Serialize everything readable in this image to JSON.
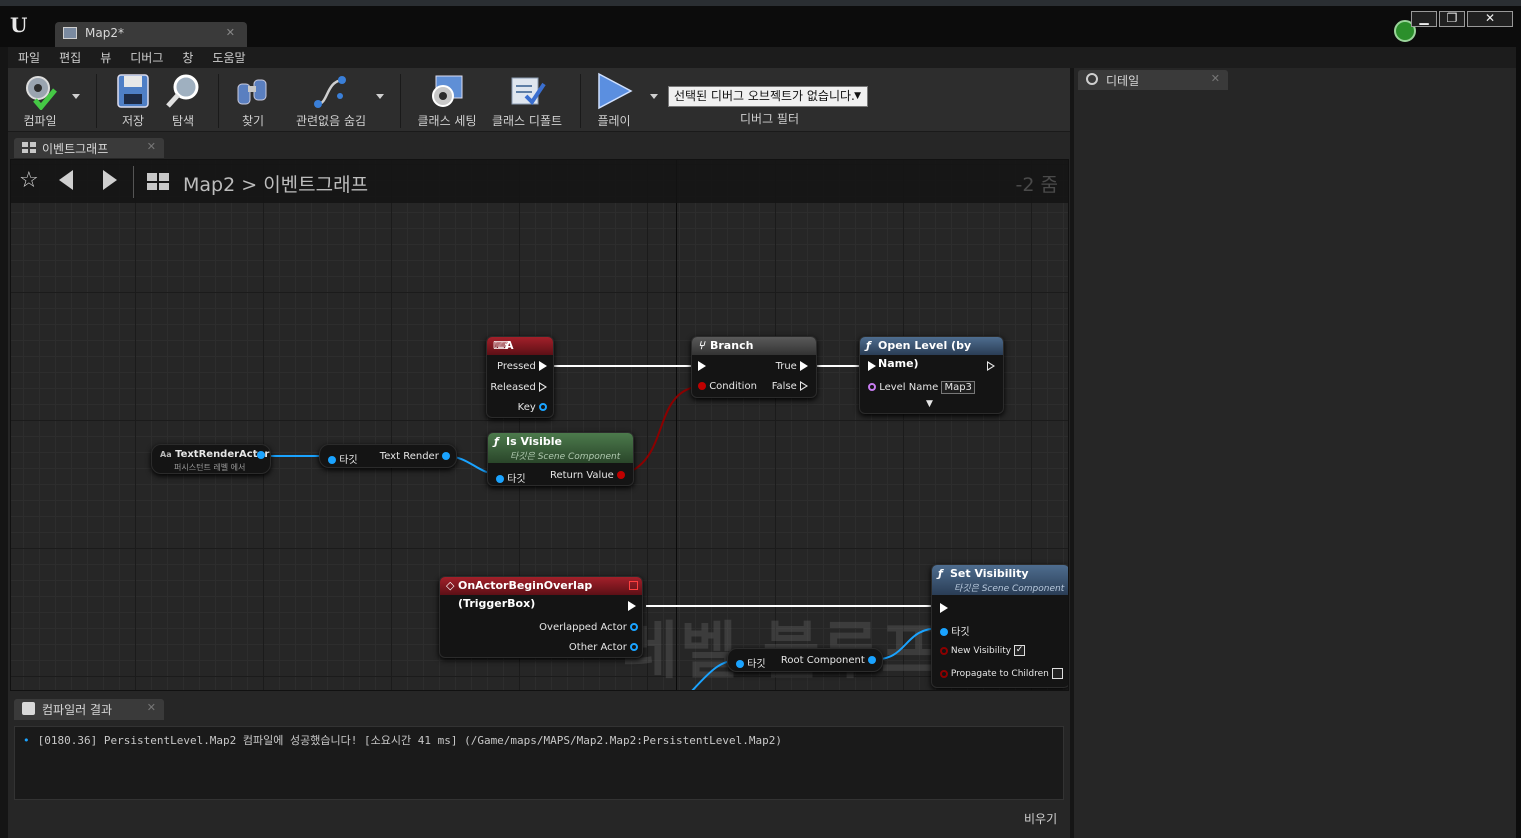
{
  "window": {
    "doc_tab_label": "Map2*",
    "min": "▁",
    "max": "❐",
    "close": "✕"
  },
  "menu": [
    "파일",
    "편집",
    "뷰",
    "디버그",
    "창",
    "도움말"
  ],
  "toolbar": {
    "compile": "컴파일",
    "save": "저장",
    "browse": "탐색",
    "find": "찾기",
    "hide_unrelated": "관련없음 숨김",
    "class_settings": "클래스 세팅",
    "class_defaults": "클래스 디폴트",
    "play": "플레이",
    "debug_object": "선택된 디버그 오브젝트가 없습니다.",
    "debug_filter": "디버그 필터"
  },
  "graph_tab": {
    "label": "이벤트그래프"
  },
  "breadcrumb": {
    "root": "Map2",
    "sep": ">",
    "current": "이벤트그래프",
    "zoom": "-2 줌"
  },
  "watermark": "레벨 블루프린트",
  "nodes": {
    "key_a": {
      "title": "A",
      "pressed": "Pressed",
      "released": "Released",
      "key": "Key"
    },
    "branch": {
      "title": "Branch",
      "true": "True",
      "false": "False",
      "condition": "Condition"
    },
    "open_level": {
      "title": "Open Level (by Name)",
      "level_name": "Level Name",
      "level_value": "Map3"
    },
    "text_render_actor": {
      "title": "TextRenderActor",
      "sub": "퍼시스턴트 레벨 에서"
    },
    "text_render_get": {
      "target": "타깃",
      "out": "Text Render"
    },
    "is_visible": {
      "title": "Is Visible",
      "sub": "타깃은 Scene Component",
      "target": "타깃",
      "ret": "Return Value"
    },
    "overlap": {
      "title": "OnActorBeginOverlap (TriggerBox)",
      "overlapped": "Overlapped Actor",
      "other": "Other Actor"
    },
    "root_comp": {
      "target": "타깃",
      "out": "Root Component"
    },
    "set_visibility": {
      "title": "Set Visibility",
      "sub": "타깃은 Scene Component",
      "target": "타깃",
      "new_vis": "New Visibility",
      "propagate": "Propagate to Children",
      "check": "✓"
    }
  },
  "compiler": {
    "tab": "컴파일러 결과",
    "log": "[0180.36] PersistentLevel.Map2 컴파일에 성공했습니다! [소요시간 41 ms] (/Game/maps/MAPS/Map2.Map2:PersistentLevel.Map2)",
    "clear": "비우기"
  },
  "details": {
    "tab": "디테일"
  }
}
